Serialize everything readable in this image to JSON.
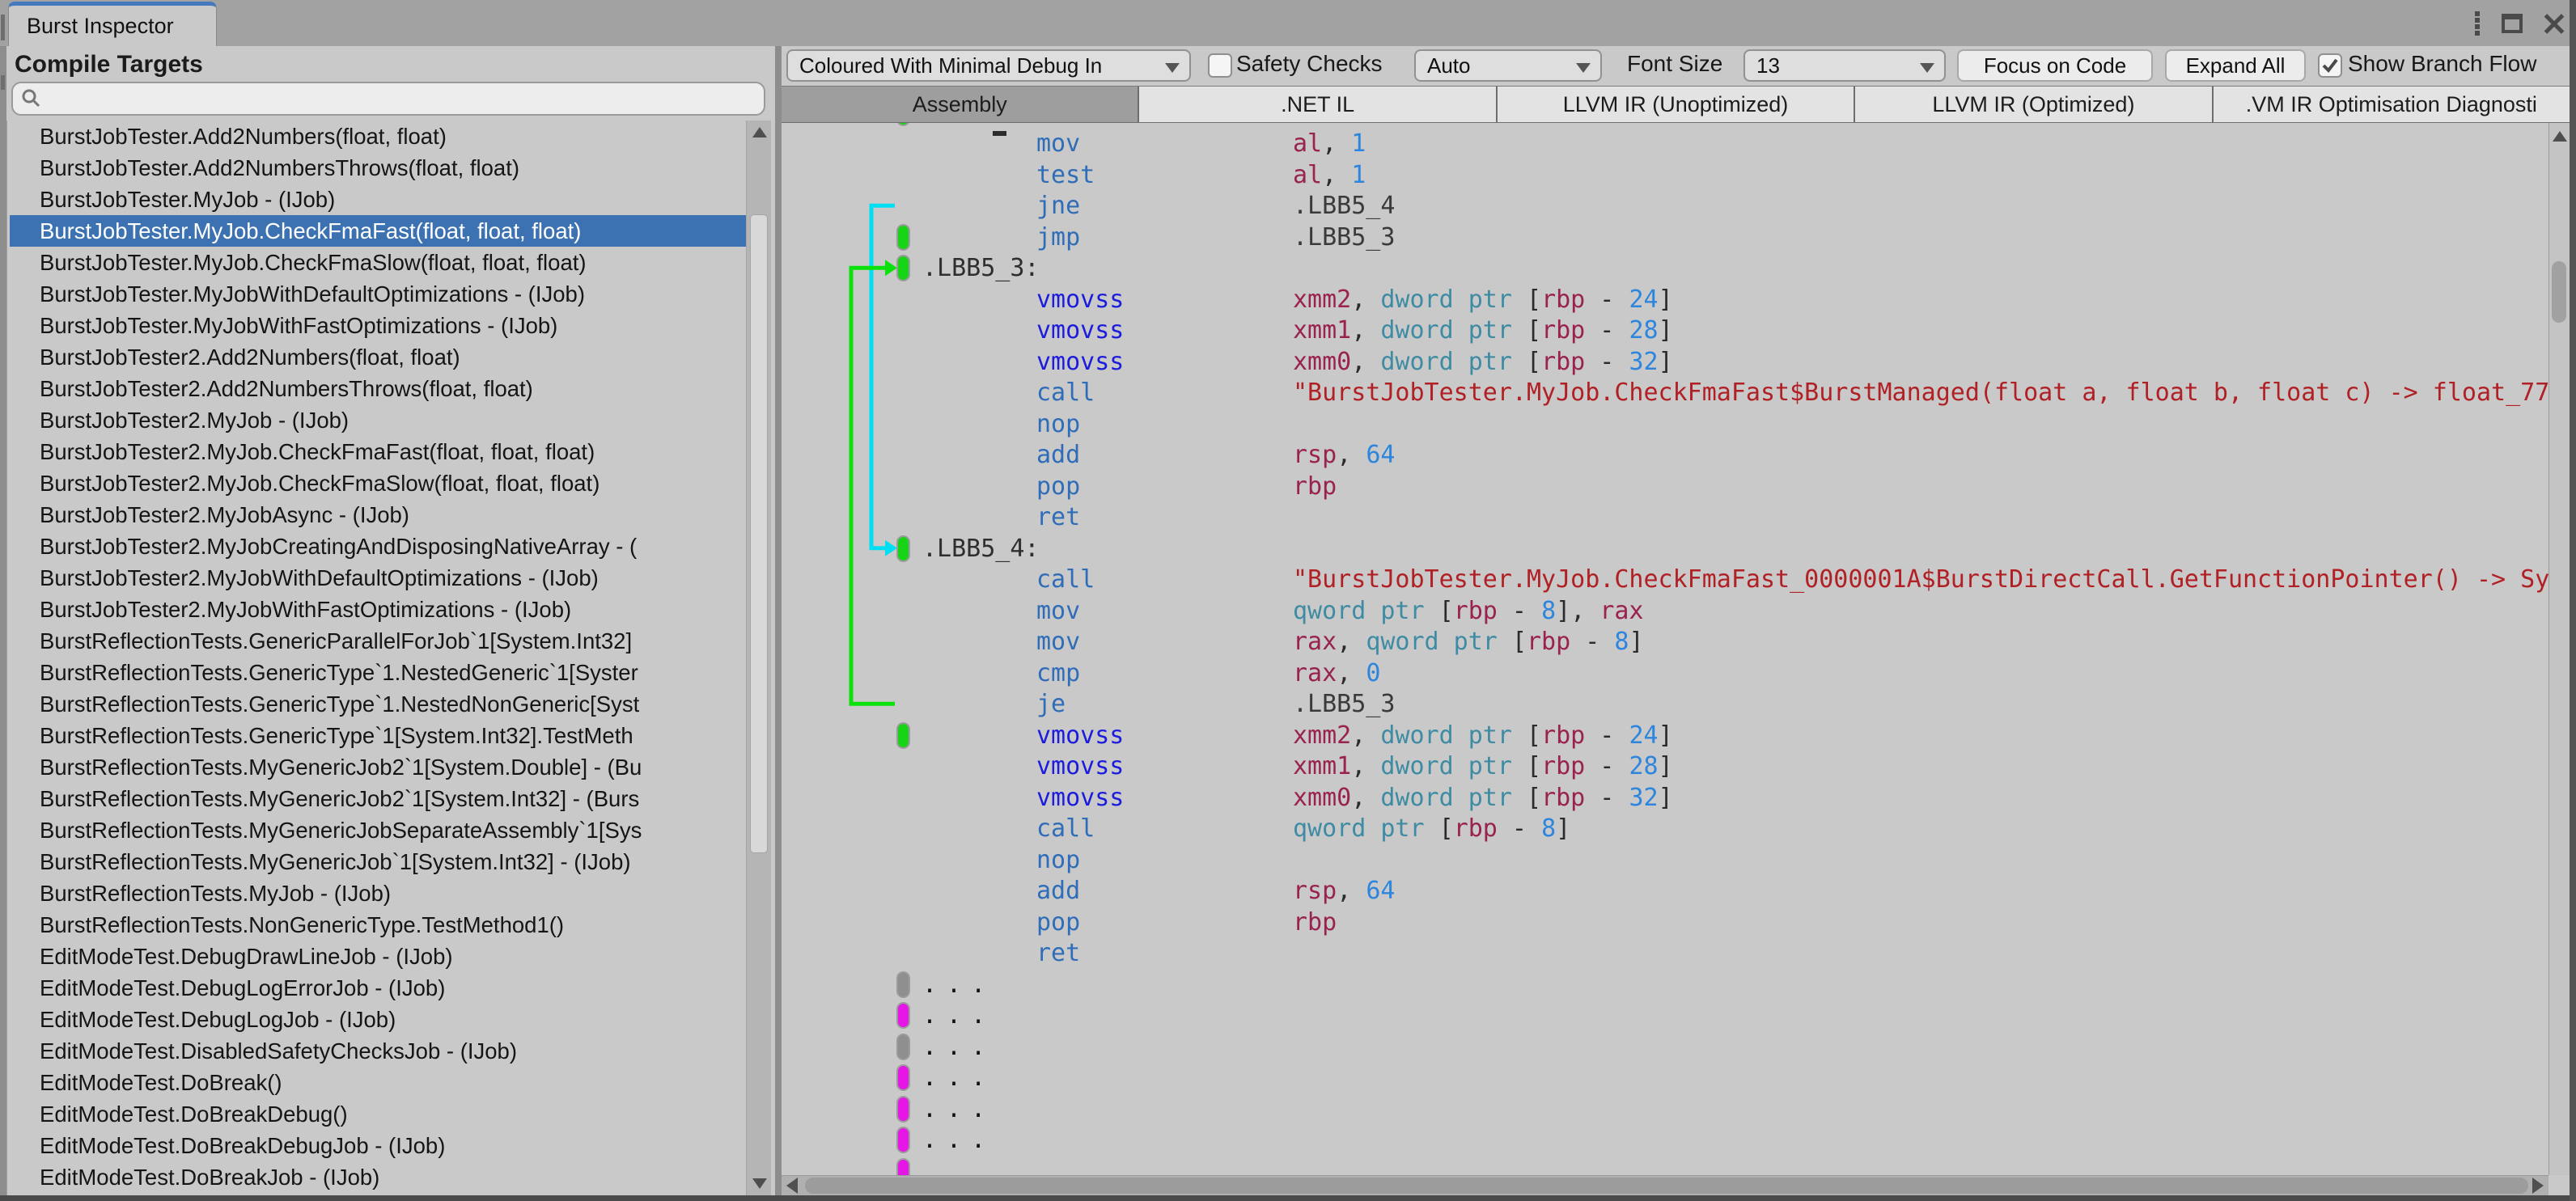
{
  "window": {
    "title": "Burst Inspector",
    "icons": [
      "kebab-menu-icon",
      "maximize-icon",
      "close-icon"
    ]
  },
  "left_panel": {
    "header": "Compile Targets",
    "search": {
      "placeholder": "",
      "icon": "search-icon"
    },
    "items": [
      {
        "label": "BurstJobTester.Add2Numbers(float, float)",
        "selected": false
      },
      {
        "label": "BurstJobTester.Add2NumbersThrows(float, float)",
        "selected": false
      },
      {
        "label": "BurstJobTester.MyJob - (IJob)",
        "selected": false
      },
      {
        "label": "BurstJobTester.MyJob.CheckFmaFast(float, float, float)",
        "selected": true
      },
      {
        "label": "BurstJobTester.MyJob.CheckFmaSlow(float, float, float)",
        "selected": false
      },
      {
        "label": "BurstJobTester.MyJobWithDefaultOptimizations - (IJob)",
        "selected": false
      },
      {
        "label": "BurstJobTester.MyJobWithFastOptimizations - (IJob)",
        "selected": false
      },
      {
        "label": "BurstJobTester2.Add2Numbers(float, float)",
        "selected": false
      },
      {
        "label": "BurstJobTester2.Add2NumbersThrows(float, float)",
        "selected": false
      },
      {
        "label": "BurstJobTester2.MyJob - (IJob)",
        "selected": false
      },
      {
        "label": "BurstJobTester2.MyJob.CheckFmaFast(float, float, float)",
        "selected": false
      },
      {
        "label": "BurstJobTester2.MyJob.CheckFmaSlow(float, float, float)",
        "selected": false
      },
      {
        "label": "BurstJobTester2.MyJobAsync - (IJob)",
        "selected": false
      },
      {
        "label": "BurstJobTester2.MyJobCreatingAndDisposingNativeArray - (",
        "selected": false
      },
      {
        "label": "BurstJobTester2.MyJobWithDefaultOptimizations - (IJob)",
        "selected": false
      },
      {
        "label": "BurstJobTester2.MyJobWithFastOptimizations - (IJob)",
        "selected": false
      },
      {
        "label": "BurstReflectionTests.GenericParallelForJob`1[System.Int32]",
        "selected": false
      },
      {
        "label": "BurstReflectionTests.GenericType`1.NestedGeneric`1[Syster",
        "selected": false
      },
      {
        "label": "BurstReflectionTests.GenericType`1.NestedNonGeneric[Syst",
        "selected": false
      },
      {
        "label": "BurstReflectionTests.GenericType`1[System.Int32].TestMeth",
        "selected": false
      },
      {
        "label": "BurstReflectionTests.MyGenericJob2`1[System.Double] - (Bu",
        "selected": false
      },
      {
        "label": "BurstReflectionTests.MyGenericJob2`1[System.Int32] - (Burs",
        "selected": false
      },
      {
        "label": "BurstReflectionTests.MyGenericJobSeparateAssembly`1[Sys",
        "selected": false
      },
      {
        "label": "BurstReflectionTests.MyGenericJob`1[System.Int32] - (IJob)",
        "selected": false
      },
      {
        "label": "BurstReflectionTests.MyJob - (IJob)",
        "selected": false
      },
      {
        "label": "BurstReflectionTests.NonGenericType.TestMethod1()",
        "selected": false
      },
      {
        "label": "EditModeTest.DebugDrawLineJob - (IJob)",
        "selected": false
      },
      {
        "label": "EditModeTest.DebugLogErrorJob - (IJob)",
        "selected": false
      },
      {
        "label": "EditModeTest.DebugLogJob - (IJob)",
        "selected": false
      },
      {
        "label": "EditModeTest.DisabledSafetyChecksJob - (IJob)",
        "selected": false
      },
      {
        "label": "EditModeTest.DoBreak()",
        "selected": false
      },
      {
        "label": "EditModeTest.DoBreakDebug()",
        "selected": false
      },
      {
        "label": "EditModeTest.DoBreakDebugJob - (IJob)",
        "selected": false
      },
      {
        "label": "EditModeTest.DoBreakJob - (IJob)",
        "selected": false
      }
    ]
  },
  "toolbar": {
    "view_mode": {
      "value": "Coloured With Minimal Debug In"
    },
    "safety_checks": {
      "label": "Safety Checks",
      "checked": false,
      "value": "Auto"
    },
    "font_size": {
      "label": "Font Size",
      "value": "13"
    },
    "focus_on_code": "Focus on Code",
    "expand_all": "Expand All",
    "show_branch_flow": {
      "label": "Show Branch Flow",
      "checked": true
    }
  },
  "view_tabs": [
    {
      "label": "Assembly",
      "selected": true
    },
    {
      "label": ".NET IL",
      "selected": false
    },
    {
      "label": "LLVM IR (Unoptimized)",
      "selected": false
    },
    {
      "label": "LLVM IR (Optimized)",
      "selected": false
    },
    {
      "label": ".VM IR Optimisation Diagnosti",
      "selected": false
    }
  ],
  "code": {
    "colors": {
      "mnemonic": "#2f6db8",
      "simd_mnemonic": "#1c1cdc",
      "register": "#99224f",
      "number": "#2d85dd",
      "pointer_keyword": "#3e8ba3",
      "call_string": "#b02024",
      "label": "#3a3a3a",
      "branch_cyan": "#00dff2",
      "branch_green": "#0be20b",
      "marker_green": "#17d417",
      "marker_magenta": "#e617e6",
      "marker_gray": "#8f8f8f"
    },
    "branch_flows": [
      {
        "from_line": 3,
        "to_line": 14,
        "color": "cyan"
      },
      {
        "from_line": 19,
        "to_line": 5,
        "color": "green"
      }
    ],
    "lines": [
      {
        "frag": true,
        "marker": "green"
      },
      {
        "mn": "mov",
        "c": "mn",
        "ops": [
          [
            "al",
            "reg"
          ],
          [
            ", ",
            "pun"
          ],
          [
            "1",
            "num"
          ]
        ]
      },
      {
        "mn": "test",
        "c": "mn",
        "ops": [
          [
            "al",
            "reg"
          ],
          [
            ", ",
            "pun"
          ],
          [
            "1",
            "num"
          ]
        ]
      },
      {
        "mn": "jne",
        "c": "mn",
        "ops": [
          [
            ".LBB5_4",
            "lbl"
          ]
        ]
      },
      {
        "mn": "jmp",
        "c": "mn",
        "marker": "green",
        "ops": [
          [
            ".LBB5_3",
            "lbl"
          ]
        ]
      },
      {
        "label": ".LBB5_3:",
        "marker": "green"
      },
      {
        "mn": "vmovss",
        "c": "simd",
        "ops": [
          [
            "xmm2",
            "reg"
          ],
          [
            ", ",
            "pun"
          ],
          [
            "dword ptr ",
            "ptr"
          ],
          [
            "[",
            "pun"
          ],
          [
            "rbp",
            "reg"
          ],
          [
            " - ",
            "pun"
          ],
          [
            "24",
            "num"
          ],
          [
            "]",
            "pun"
          ]
        ]
      },
      {
        "mn": "vmovss",
        "c": "simd",
        "ops": [
          [
            "xmm1",
            "reg"
          ],
          [
            ", ",
            "pun"
          ],
          [
            "dword ptr ",
            "ptr"
          ],
          [
            "[",
            "pun"
          ],
          [
            "rbp",
            "reg"
          ],
          [
            " - ",
            "pun"
          ],
          [
            "28",
            "num"
          ],
          [
            "]",
            "pun"
          ]
        ]
      },
      {
        "mn": "vmovss",
        "c": "simd",
        "ops": [
          [
            "xmm0",
            "reg"
          ],
          [
            ", ",
            "pun"
          ],
          [
            "dword ptr ",
            "ptr"
          ],
          [
            "[",
            "pun"
          ],
          [
            "rbp",
            "reg"
          ],
          [
            " - ",
            "pun"
          ],
          [
            "32",
            "num"
          ],
          [
            "]",
            "pun"
          ]
        ]
      },
      {
        "mn": "call",
        "c": "mn",
        "ops": [
          [
            "\"BurstJobTester.MyJob.CheckFmaFast$BurstManaged(float a, float b, float c) -> float_77",
            "str"
          ]
        ]
      },
      {
        "mn": "nop",
        "c": "mn",
        "ops": []
      },
      {
        "mn": "add",
        "c": "mn",
        "ops": [
          [
            "rsp",
            "reg"
          ],
          [
            ", ",
            "pun"
          ],
          [
            "64",
            "num"
          ]
        ]
      },
      {
        "mn": "pop",
        "c": "mn",
        "ops": [
          [
            "rbp",
            "reg"
          ]
        ]
      },
      {
        "mn": "ret",
        "c": "mn",
        "ops": []
      },
      {
        "label": ".LBB5_4:",
        "marker": "green"
      },
      {
        "mn": "call",
        "c": "mn",
        "ops": [
          [
            "\"BurstJobTester.MyJob.CheckFmaFast_0000001A$BurstDirectCall.GetFunctionPointer() -> Sy",
            "str"
          ]
        ]
      },
      {
        "mn": "mov",
        "c": "mn",
        "ops": [
          [
            "qword ptr ",
            "ptr"
          ],
          [
            "[",
            "pun"
          ],
          [
            "rbp",
            "reg"
          ],
          [
            " - ",
            "pun"
          ],
          [
            "8",
            "num"
          ],
          [
            "]",
            "pun"
          ],
          [
            ", ",
            "pun"
          ],
          [
            "rax",
            "reg"
          ]
        ]
      },
      {
        "mn": "mov",
        "c": "mn",
        "ops": [
          [
            "rax",
            "reg"
          ],
          [
            ", ",
            "pun"
          ],
          [
            "qword ptr ",
            "ptr"
          ],
          [
            "[",
            "pun"
          ],
          [
            "rbp",
            "reg"
          ],
          [
            " - ",
            "pun"
          ],
          [
            "8",
            "num"
          ],
          [
            "]",
            "pun"
          ]
        ]
      },
      {
        "mn": "cmp",
        "c": "mn",
        "ops": [
          [
            "rax",
            "reg"
          ],
          [
            ", ",
            "pun"
          ],
          [
            "0",
            "num"
          ]
        ]
      },
      {
        "mn": "je",
        "c": "mn",
        "ops": [
          [
            ".LBB5_3",
            "lbl"
          ]
        ]
      },
      {
        "mn": "vmovss",
        "c": "simd",
        "marker": "green",
        "ops": [
          [
            "xmm2",
            "reg"
          ],
          [
            ", ",
            "pun"
          ],
          [
            "dword ptr ",
            "ptr"
          ],
          [
            "[",
            "pun"
          ],
          [
            "rbp",
            "reg"
          ],
          [
            " - ",
            "pun"
          ],
          [
            "24",
            "num"
          ],
          [
            "]",
            "pun"
          ]
        ]
      },
      {
        "mn": "vmovss",
        "c": "simd",
        "ops": [
          [
            "xmm1",
            "reg"
          ],
          [
            ", ",
            "pun"
          ],
          [
            "dword ptr ",
            "ptr"
          ],
          [
            "[",
            "pun"
          ],
          [
            "rbp",
            "reg"
          ],
          [
            " - ",
            "pun"
          ],
          [
            "28",
            "num"
          ],
          [
            "]",
            "pun"
          ]
        ]
      },
      {
        "mn": "vmovss",
        "c": "simd",
        "ops": [
          [
            "xmm0",
            "reg"
          ],
          [
            ", ",
            "pun"
          ],
          [
            "dword ptr ",
            "ptr"
          ],
          [
            "[",
            "pun"
          ],
          [
            "rbp",
            "reg"
          ],
          [
            " - ",
            "pun"
          ],
          [
            "32",
            "num"
          ],
          [
            "]",
            "pun"
          ]
        ]
      },
      {
        "mn": "call",
        "c": "mn",
        "ops": [
          [
            "qword ptr ",
            "ptr"
          ],
          [
            "[",
            "pun"
          ],
          [
            "rbp",
            "reg"
          ],
          [
            " - ",
            "pun"
          ],
          [
            "8",
            "num"
          ],
          [
            "]",
            "pun"
          ]
        ]
      },
      {
        "mn": "nop",
        "c": "mn",
        "ops": []
      },
      {
        "mn": "add",
        "c": "mn",
        "ops": [
          [
            "rsp",
            "reg"
          ],
          [
            ", ",
            "pun"
          ],
          [
            "64",
            "num"
          ]
        ]
      },
      {
        "mn": "pop",
        "c": "mn",
        "ops": [
          [
            "rbp",
            "reg"
          ]
        ]
      },
      {
        "mn": "ret",
        "c": "mn",
        "ops": []
      },
      {
        "dots": "...",
        "marker": "gray"
      },
      {
        "dots": "...",
        "marker": "magenta"
      },
      {
        "dots": "...",
        "marker": "gray"
      },
      {
        "dots": "...",
        "marker": "magenta"
      },
      {
        "dots": "...",
        "marker": "magenta"
      },
      {
        "dots": "...",
        "marker": "magenta"
      },
      {
        "dots": "...",
        "marker": "magenta"
      }
    ]
  }
}
